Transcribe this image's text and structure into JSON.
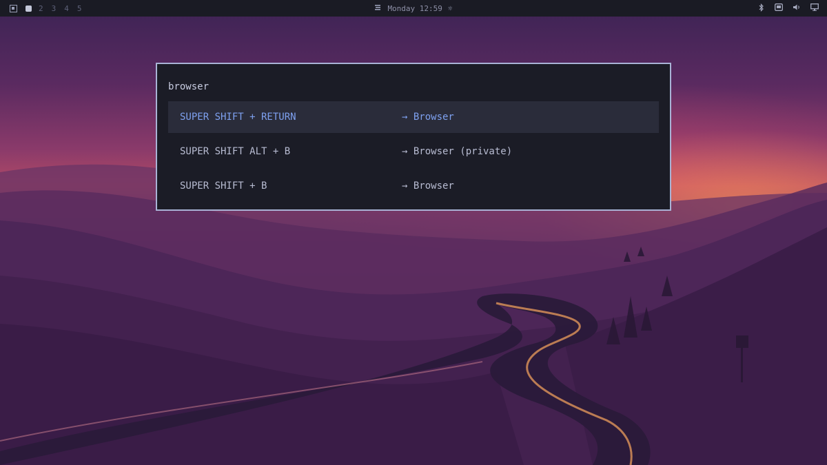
{
  "topbar": {
    "workspaces": [
      "2",
      "3",
      "4",
      "5"
    ],
    "clock": "Monday 12:59",
    "icons": [
      "workspace-overview-icon",
      "active-workspace-icon",
      "weather-icon",
      "sun-icon",
      "bluetooth-icon",
      "monitor-icon",
      "volume-icon",
      "display-icon"
    ]
  },
  "launcher": {
    "query": "browser",
    "items": [
      {
        "keys": "SUPER SHIFT + RETURN",
        "action": "→ Browser"
      },
      {
        "keys": "SUPER SHIFT ALT + B",
        "action": "→ Browser (private)"
      },
      {
        "keys": "SUPER SHIFT + B",
        "action": "→ Browser"
      }
    ],
    "selected_index": 0
  },
  "colors": {
    "bar_bg": "#1a1b24",
    "launcher_bg": "#1b1c26",
    "launcher_border": "#a9b3d6",
    "selected_bg": "#2a2c3a",
    "accent": "#7ea1f0"
  }
}
